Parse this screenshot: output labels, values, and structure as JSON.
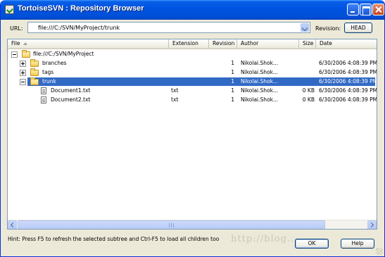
{
  "window": {
    "title": "TortoiseSVN : Repository Browser"
  },
  "url_bar": {
    "label": "URL:",
    "value": "file:///C:/SVN/MyProject/trunk",
    "revision_label": "Revision:",
    "revision_button": "HEAD"
  },
  "columns": {
    "file": "File",
    "extension": "Extension",
    "revision": "Revision",
    "author": "Author",
    "size": "Size",
    "date": "Date"
  },
  "rows": [
    {
      "name": "file:///C:/SVN/MyProject",
      "extension": "",
      "revision": "",
      "author": "",
      "size": "",
      "date": "",
      "icon": "folder-open-icon",
      "expander": "minus"
    },
    {
      "name": "branches",
      "extension": "",
      "revision": "1",
      "author": "Nikolai.Shok...",
      "size": "",
      "date": "6/30/2006 4:08:39 PM",
      "icon": "folder-icon",
      "expander": "plus"
    },
    {
      "name": "tags",
      "extension": "",
      "revision": "1",
      "author": "Nikolai.Shok...",
      "size": "",
      "date": "6/30/2006 4:08:39 PM",
      "icon": "folder-icon",
      "expander": "plus"
    },
    {
      "name": "trunk",
      "extension": "",
      "revision": "1",
      "author": "Nikolai.Shok...",
      "size": "",
      "date": "6/30/2006 4:08:39 PM",
      "icon": "folder-open-icon",
      "expander": "minus",
      "selected": true
    },
    {
      "name": "Document1.txt",
      "extension": "txt",
      "revision": "1",
      "author": "Nikolai.Shok...",
      "size": "0 KB",
      "date": "6/30/2006 4:08:39 PM",
      "icon": "text-file-icon"
    },
    {
      "name": "Document2.txt",
      "extension": "txt",
      "revision": "1",
      "author": "Nikolai.Shok...",
      "size": "0 KB",
      "date": "6/30/2006 4:08:39 PM",
      "icon": "text-file-icon"
    }
  ],
  "hint": "Hint: Press F5 to refresh the selected subtree and Ctrl-F5 to load all children too",
  "buttons": {
    "ok": "OK",
    "help": "Help"
  },
  "watermark": "http://blog..."
}
